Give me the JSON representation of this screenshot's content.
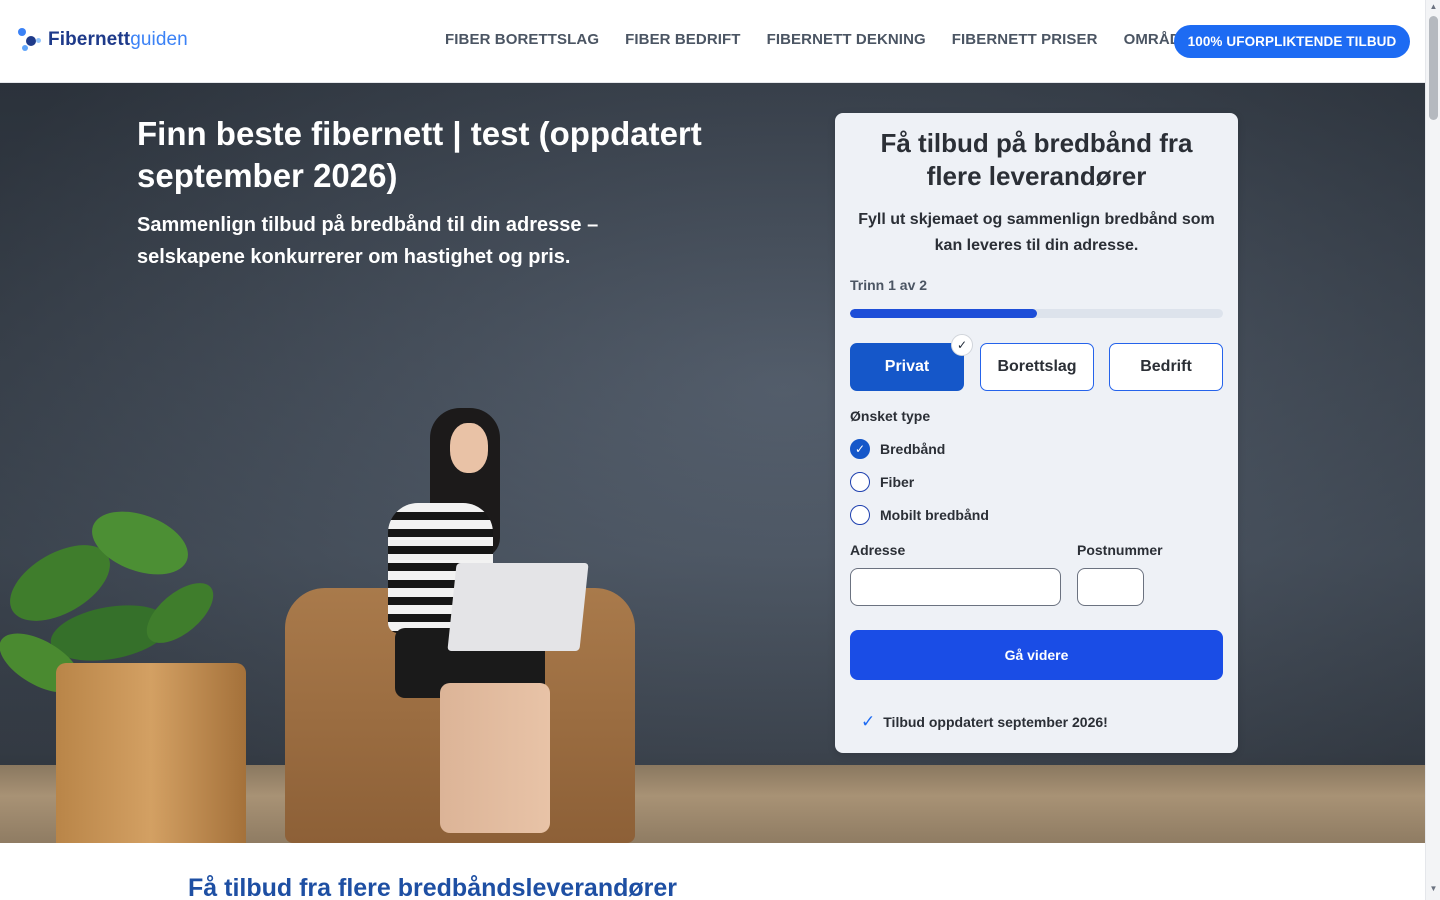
{
  "header": {
    "logo_part1": "Fibernett",
    "logo_part2": "guiden",
    "nav": [
      "FIBER BORETTSLAG",
      "FIBER BEDRIFT",
      "FIBERNETT DEKNING",
      "FIBERNETT PRISER",
      "OMRÅDER"
    ],
    "cta": "100% UFORPLIKTENDE TILBUD"
  },
  "hero": {
    "title": "Finn beste fibernett | test (oppdatert september 2026)",
    "subtitle": "Sammenlign tilbud på bredbånd til din adresse – selskapene konkurrerer om hastighet og pris."
  },
  "form": {
    "title": "Få tilbud på bredbånd fra flere leverandører",
    "description": "Fyll ut skjemaet og sammenlign bredbånd som kan leveres til din adresse.",
    "step": "Trinn 1 av 2",
    "progress_fraction": 0.5,
    "segments": [
      {
        "label": "Privat",
        "selected": true
      },
      {
        "label": "Borettslag",
        "selected": false
      },
      {
        "label": "Bedrift",
        "selected": false
      }
    ],
    "type_label": "Ønsket type",
    "types": [
      {
        "label": "Bredbånd",
        "checked": true
      },
      {
        "label": "Fiber",
        "checked": false
      },
      {
        "label": "Mobilt bredbånd",
        "checked": false
      }
    ],
    "address_label": "Adresse",
    "address_value": "",
    "postal_label": "Postnummer",
    "postal_value": "",
    "submit": "Gå videre ",
    "note": "Tilbud oppdatert september 2026!"
  },
  "below": {
    "section_title": "Få tilbud fra flere bredbåndsleverandører"
  },
  "colors": {
    "brand_blue": "#1d6bf3",
    "primary_dark": "#1557c9",
    "section_title": "#1e4fa3"
  },
  "icons": {
    "logo": "dots-logo-icon",
    "segment_selected": "check-icon",
    "radio_checked": "check-icon",
    "note": "checkmark-icon"
  }
}
